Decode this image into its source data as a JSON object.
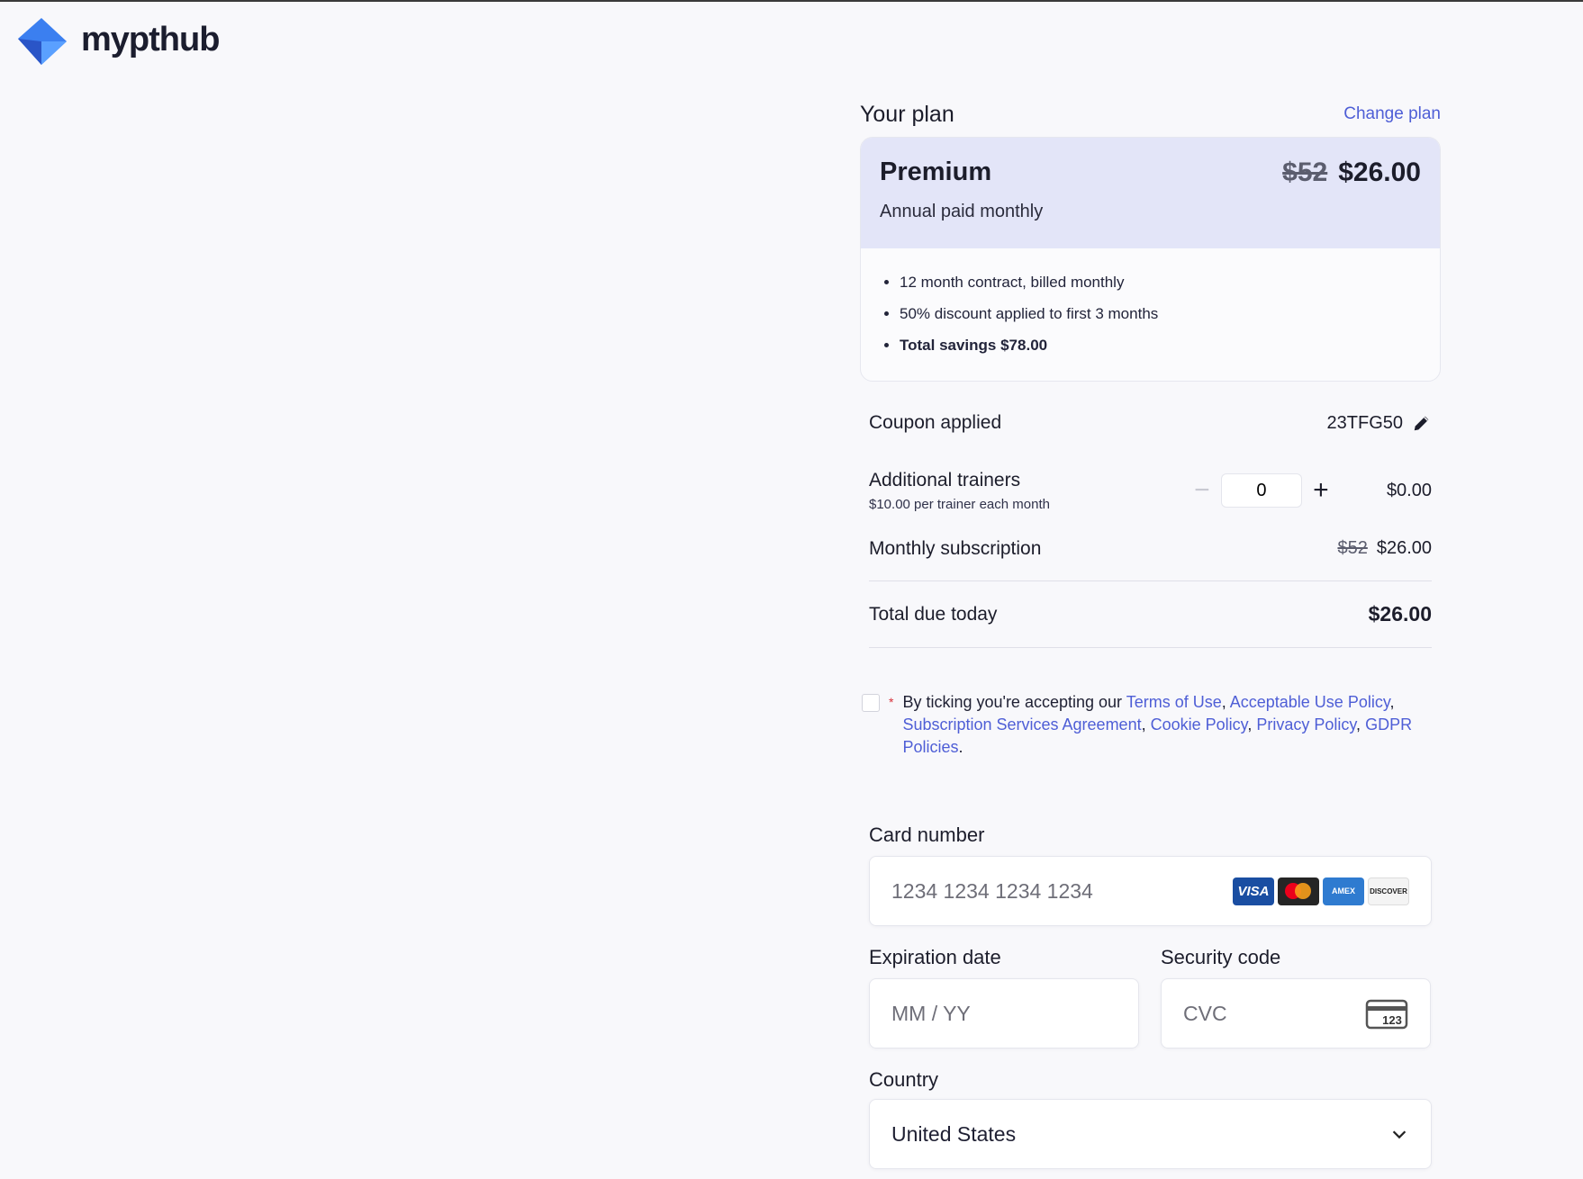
{
  "brand": {
    "name": "mypthub"
  },
  "plan": {
    "heading": "Your plan",
    "change_label": "Change plan",
    "name": "Premium",
    "billing": "Annual paid monthly",
    "old_price": "$52",
    "price": "$26.00",
    "features": [
      "12 month contract, billed monthly",
      "50% discount applied to first 3 months",
      "Total savings $78.00"
    ]
  },
  "summary": {
    "coupon_label": "Coupon applied",
    "coupon_code": "23TFG50",
    "trainers_label": "Additional trainers",
    "trainers_sub": "$10.00 per trainer each month",
    "trainers_qty": "0",
    "trainers_price": "$0.00",
    "monthly_label": "Monthly subscription",
    "monthly_old": "$52",
    "monthly_price": "$26.00",
    "total_label": "Total due today",
    "total_price": "$26.00"
  },
  "terms": {
    "required_mark": "*",
    "prefix": "By ticking you're accepting our ",
    "links": [
      "Terms of Use",
      "Acceptable Use Policy",
      "Subscription Services Agreement",
      "Cookie Policy",
      "Privacy Policy",
      "GDPR Policies"
    ],
    "sep": ", ",
    "end": "."
  },
  "payment": {
    "card_label": "Card number",
    "card_placeholder": "1234 1234 1234 1234",
    "card_brands": [
      "VISA",
      "",
      "AMEX",
      "DISCOVER"
    ],
    "exp_label": "Expiration date",
    "exp_placeholder": "MM / YY",
    "cvc_label": "Security code",
    "cvc_placeholder": "CVC",
    "cvc_icon_text": "123",
    "country_label": "Country",
    "country_value": "United States"
  },
  "colors": {
    "accent": "#4e5ed6",
    "plan_header_bg": "#e3e5f8",
    "logo_blue": "#3b7ff0"
  },
  "icons": [
    "logo-mark-icon",
    "pencil-icon",
    "minus-icon",
    "plus-icon",
    "card-brand-icons",
    "cvc-card-icon",
    "chevron-down-icon"
  ]
}
